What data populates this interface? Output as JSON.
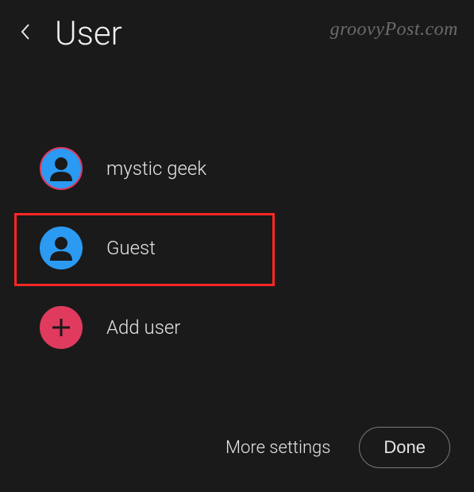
{
  "header": {
    "title": "User"
  },
  "watermark": "groovyPost.com",
  "users": [
    {
      "label": "mystic geek"
    },
    {
      "label": "Guest"
    }
  ],
  "add_user": {
    "label": "Add user"
  },
  "footer": {
    "more_settings": "More settings",
    "done": "Done"
  }
}
